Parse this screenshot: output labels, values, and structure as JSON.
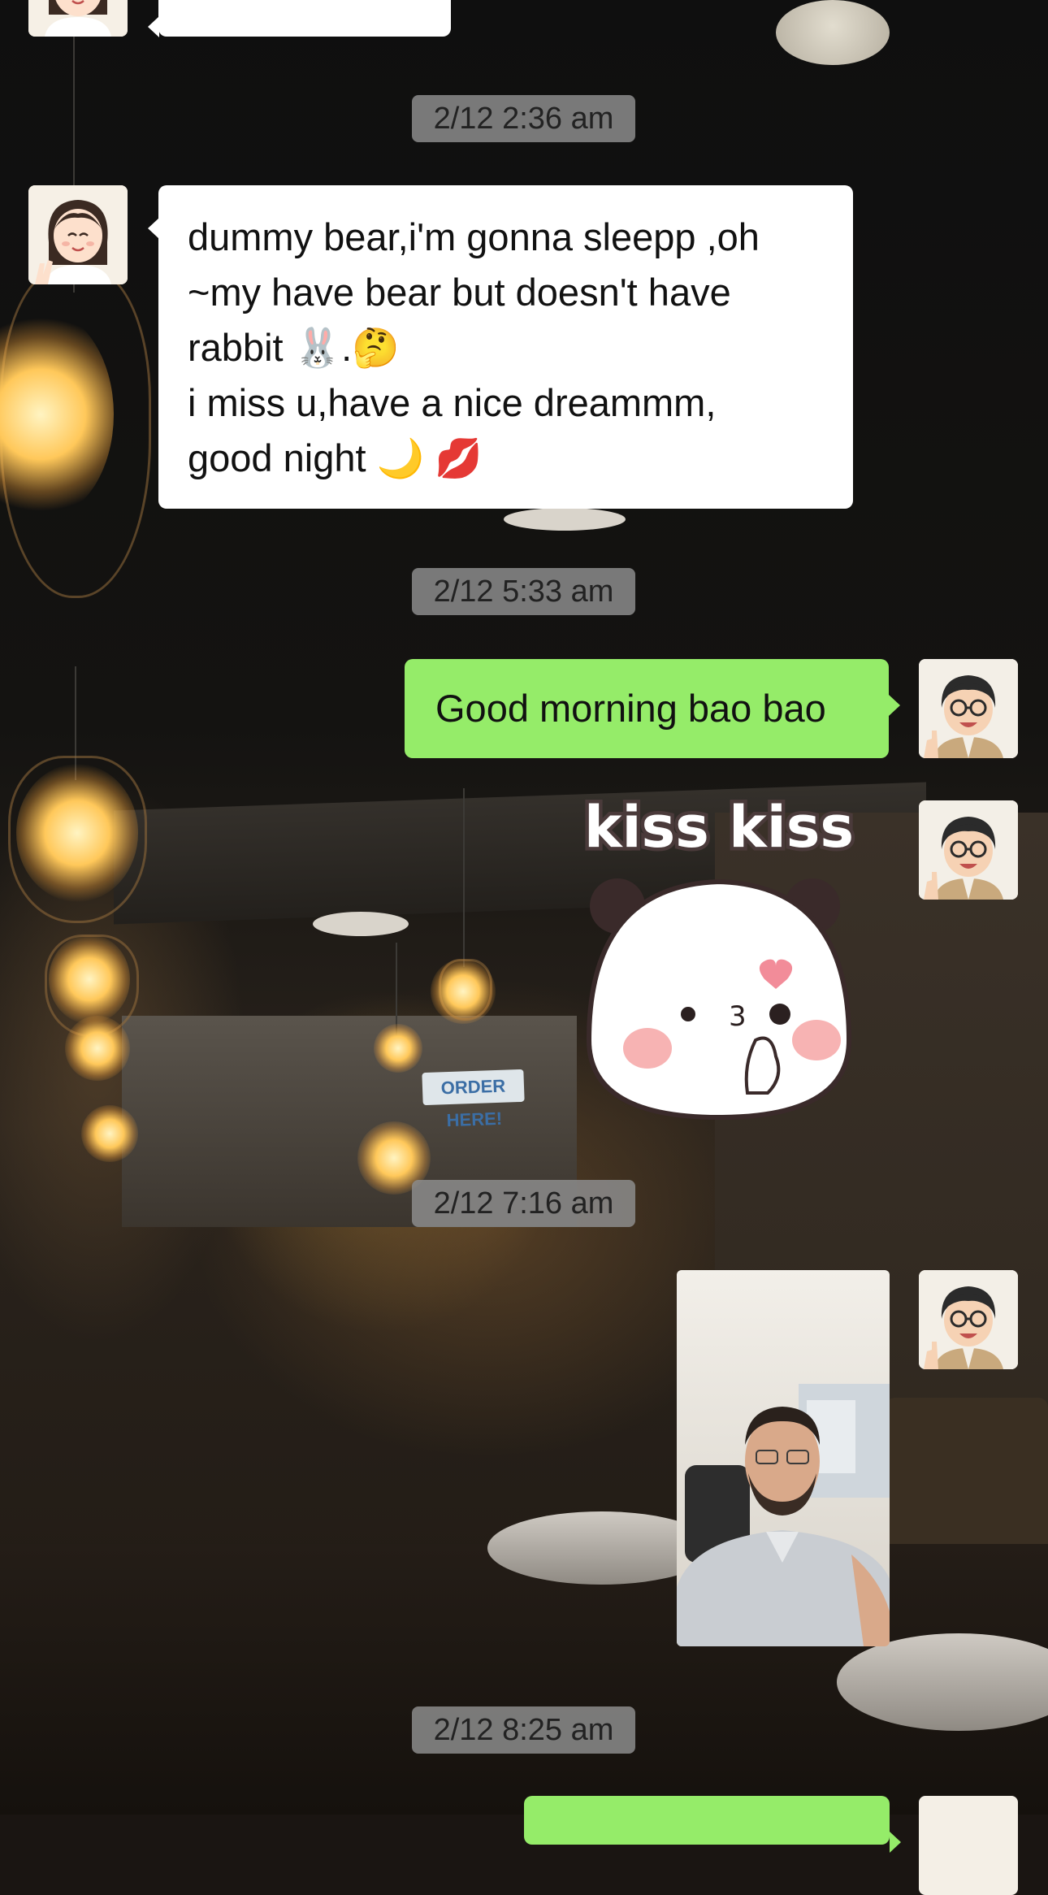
{
  "chat": {
    "messages": [
      {
        "sender": "her",
        "type": "text",
        "lines": [
          "dummy bear,i'm gonna sleepp ,oh",
          "~my have bear but doesn't have",
          "rabbit 🐰.🤔",
          "i miss u,have a nice dreammm,",
          "good night 🌙 💋"
        ]
      },
      {
        "sender": "me",
        "type": "text",
        "text": "Good morning bao bao"
      },
      {
        "sender": "me",
        "type": "sticker",
        "text": "kiss kiss"
      },
      {
        "sender": "me",
        "type": "photo"
      }
    ],
    "timestamps": [
      "2/12 2:36 am",
      "2/12 5:33 am",
      "2/12 7:16 am",
      "2/12 8:25 am"
    ],
    "background_sign": "ORDER HERE!"
  },
  "colors": {
    "incoming_bubble": "#ffffff",
    "outgoing_bubble": "#95ec69",
    "timestamp_bg": "#8c8c8c"
  },
  "icons": [
    "avatar-her",
    "avatar-me",
    "panda-sticker"
  ]
}
